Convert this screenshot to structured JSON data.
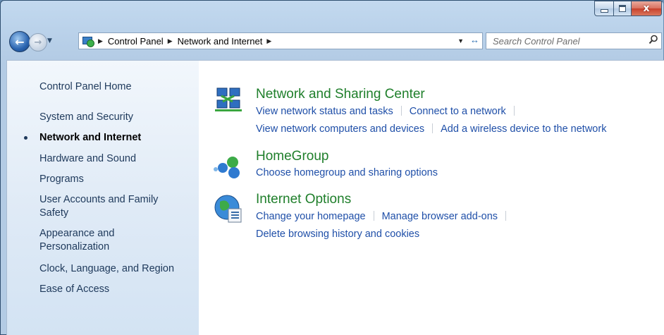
{
  "window": {
    "caption": {
      "minimize": "",
      "maximize": "",
      "close": "x"
    }
  },
  "nav": {
    "breadcrumb": [
      "Control Panel",
      "Network and Internet"
    ],
    "search_placeholder": "Search Control Panel"
  },
  "sidebar": {
    "items": [
      {
        "label": "Control Panel Home",
        "active": false
      },
      {
        "label": "System and Security",
        "active": false
      },
      {
        "label": "Network and Internet",
        "active": true
      },
      {
        "label": "Hardware and Sound",
        "active": false
      },
      {
        "label": "Programs",
        "active": false
      },
      {
        "label": "User Accounts and Family Safety",
        "active": false
      },
      {
        "label": "Appearance and Personalization",
        "active": false
      },
      {
        "label": "Clock, Language, and Region",
        "active": false
      },
      {
        "label": "Ease of Access",
        "active": false
      }
    ]
  },
  "categories": [
    {
      "title": "Network and Sharing Center",
      "icon": "network-sharing-icon",
      "links": [
        [
          "View network status and tasks",
          "Connect to a network"
        ],
        [
          "View network computers and devices",
          "Add a wireless device to the network"
        ]
      ]
    },
    {
      "title": "HomeGroup",
      "icon": "homegroup-icon",
      "links": [
        [
          "Choose homegroup and sharing options"
        ]
      ]
    },
    {
      "title": "Internet Options",
      "icon": "internet-options-icon",
      "links": [
        [
          "Change your homepage",
          "Manage browser add-ons"
        ],
        [
          "Delete browsing history and cookies"
        ]
      ]
    }
  ],
  "colors": {
    "link": "#1f4fa8",
    "category_title": "#1f7f2b",
    "sidebar_text": "#1e395b"
  }
}
